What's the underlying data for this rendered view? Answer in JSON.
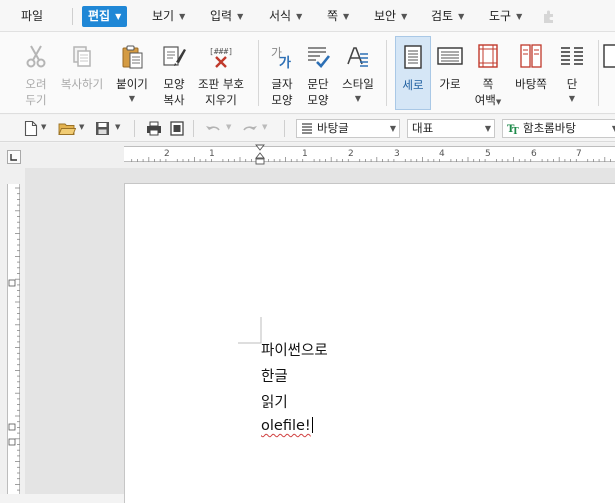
{
  "menu": {
    "file": "파일",
    "items": [
      {
        "label": "편집",
        "active": true
      },
      {
        "label": "보기"
      },
      {
        "label": "입력"
      },
      {
        "label": "서식"
      },
      {
        "label": "쪽"
      },
      {
        "label": "보안"
      },
      {
        "label": "검토"
      },
      {
        "label": "도구"
      }
    ]
  },
  "ribbon": {
    "cut": {
      "line1": "오려",
      "line2": "두기"
    },
    "copy": {
      "line1": "복사하기"
    },
    "paste": {
      "line1": "붙이기"
    },
    "format_copy": {
      "line1": "모양",
      "line2": "복사"
    },
    "clear_marks": {
      "line1": "조판 부호",
      "line2": "지우기"
    },
    "char_shape": {
      "line1": "글자",
      "line2": "모양"
    },
    "para_shape": {
      "line1": "문단",
      "line2": "모양"
    },
    "style": {
      "line1": "스타일"
    },
    "portrait": {
      "line1": "세로"
    },
    "landscape": {
      "line1": "가로"
    },
    "margins": {
      "line1": "쪽",
      "line2": "여백"
    },
    "background": {
      "line1": "바탕쪽"
    },
    "columns": {
      "line1": "단"
    }
  },
  "toolbar": {
    "style_combo": "바탕글",
    "lang_combo": "대표",
    "font_combo": "함초롬바탕"
  },
  "ruler": {
    "h_numbers": [
      "2",
      "1",
      "1",
      "2",
      "3",
      "4",
      "5",
      "6",
      "7"
    ]
  },
  "document": {
    "lines": [
      "파이썬으로",
      "한글",
      "읽기",
      "olefile!"
    ]
  },
  "colors": {
    "accent": "#1f87d6",
    "selected_bg": "#d5e6f6",
    "icon_blue": "#2c6fb5",
    "icon_red": "#c0392b"
  }
}
